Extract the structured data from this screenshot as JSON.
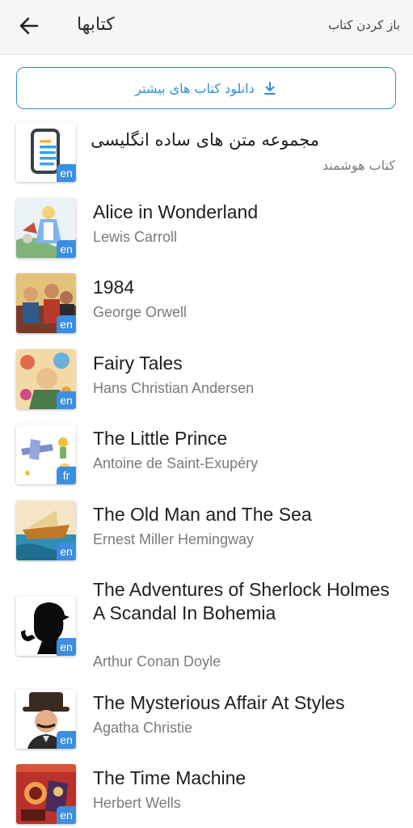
{
  "header": {
    "title": "کتابها",
    "open_book_label": "باز کردن کتاب"
  },
  "download_button": {
    "label": "دانلود کتاب های بیشتر"
  },
  "books": [
    {
      "title": "مجموعه متن های ساده انگلیسی",
      "author": "کتاب هوشمند",
      "lang": "en"
    },
    {
      "title": "Alice in Wonderland",
      "author": "Lewis Carroll",
      "lang": "en"
    },
    {
      "title": "1984",
      "author": "George Orwell",
      "lang": "en"
    },
    {
      "title": "Fairy Tales",
      "author": "Hans Christian Andersen",
      "lang": "en"
    },
    {
      "title": "The Little Prince",
      "author": "Antoine de Saint-Exupéry",
      "lang": "fr"
    },
    {
      "title": "The Old Man and The Sea",
      "author": "Ernest Miller Hemingway",
      "lang": "en"
    },
    {
      "title": "The Adventures of Sherlock Holmes\nA Scandal In Bohemia",
      "author": "Arthur Conan Doyle",
      "lang": "en"
    },
    {
      "title": "The Mysterious Affair At Styles",
      "author": "Agatha Christie",
      "lang": "en"
    },
    {
      "title": "The Time Machine",
      "author": "Herbert Wells",
      "lang": "en"
    }
  ]
}
